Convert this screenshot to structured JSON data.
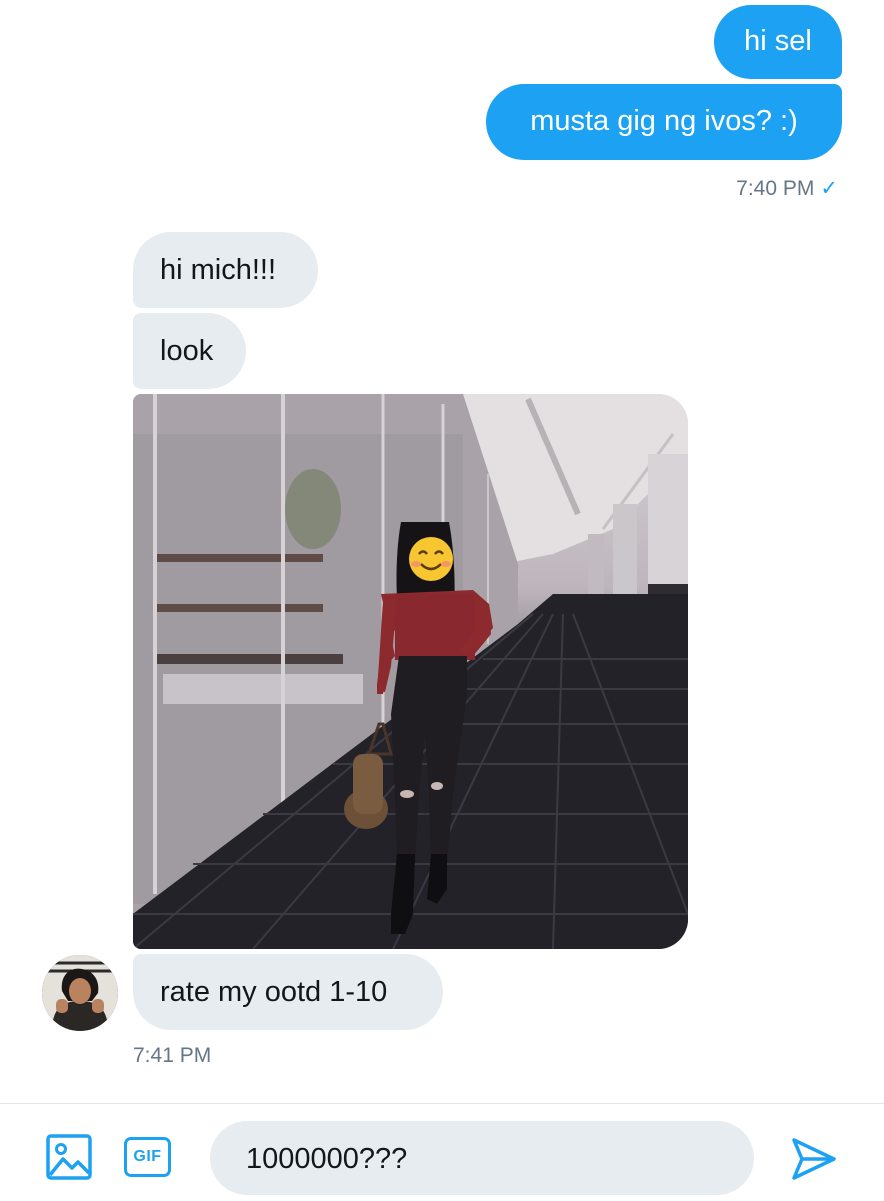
{
  "messages": {
    "sent_1": "hi sel",
    "sent_2": "musta gig ng ivos? :)",
    "sent_time": "7:40 PM",
    "received_1": "hi mich!!!",
    "received_2": "look",
    "received_photo_icon": "outfit-photo",
    "received_3": "rate my ootd 1-10",
    "received_time": "7:41 PM"
  },
  "composer": {
    "gif_label": "GIF",
    "input_value": "1000000???",
    "media_icon": "image-icon",
    "send_icon": "send-icon"
  },
  "colors": {
    "accent": "#1da1f2",
    "incoming_bubble": "#e6ecf0",
    "timestamp": "#657786"
  }
}
